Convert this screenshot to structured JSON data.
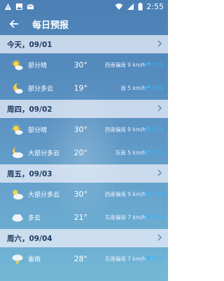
{
  "status": {
    "time": "2:55"
  },
  "toolbar": {
    "title": "每日预报"
  },
  "days": [
    {
      "label": "今天，09/01",
      "rows": [
        {
          "icon": "partly-sunny-icon",
          "desc": "部分晴",
          "temp": "30°",
          "wind": "西南偏南 9 km/h",
          "rain": "15%"
        },
        {
          "icon": "night-partly-cloudy-icon",
          "desc": "部分多云",
          "temp": "19°",
          "wind": "南 5 km/h",
          "rain": "10%"
        }
      ]
    },
    {
      "label": "周四，09/02",
      "rows": [
        {
          "icon": "partly-sunny-icon",
          "desc": "部分晴",
          "temp": "30°",
          "wind": "西南偏南 9 km/h",
          "rain": "11%"
        },
        {
          "icon": "night-mostly-cloudy-icon",
          "desc": "大部分多云",
          "temp": "20°",
          "wind": "东南 5 km/h",
          "rain": "13%"
        }
      ]
    },
    {
      "label": "周五，09/03",
      "rows": [
        {
          "icon": "mostly-cloudy-icon",
          "desc": "大部分多云",
          "temp": "30°",
          "wind": "西南偏南 9 km/h",
          "rain": "14%"
        },
        {
          "icon": "cloudy-icon",
          "desc": "多云",
          "temp": "21°",
          "wind": "东南偏南 7 km/h",
          "rain": "25%"
        }
      ]
    },
    {
      "label": "周六，09/04",
      "rows": [
        {
          "icon": "thunderstorm-icon",
          "desc": "雷雨",
          "temp": "28°",
          "wind": "东南偏南 7 km/h",
          "rain": "52%"
        }
      ]
    }
  ]
}
